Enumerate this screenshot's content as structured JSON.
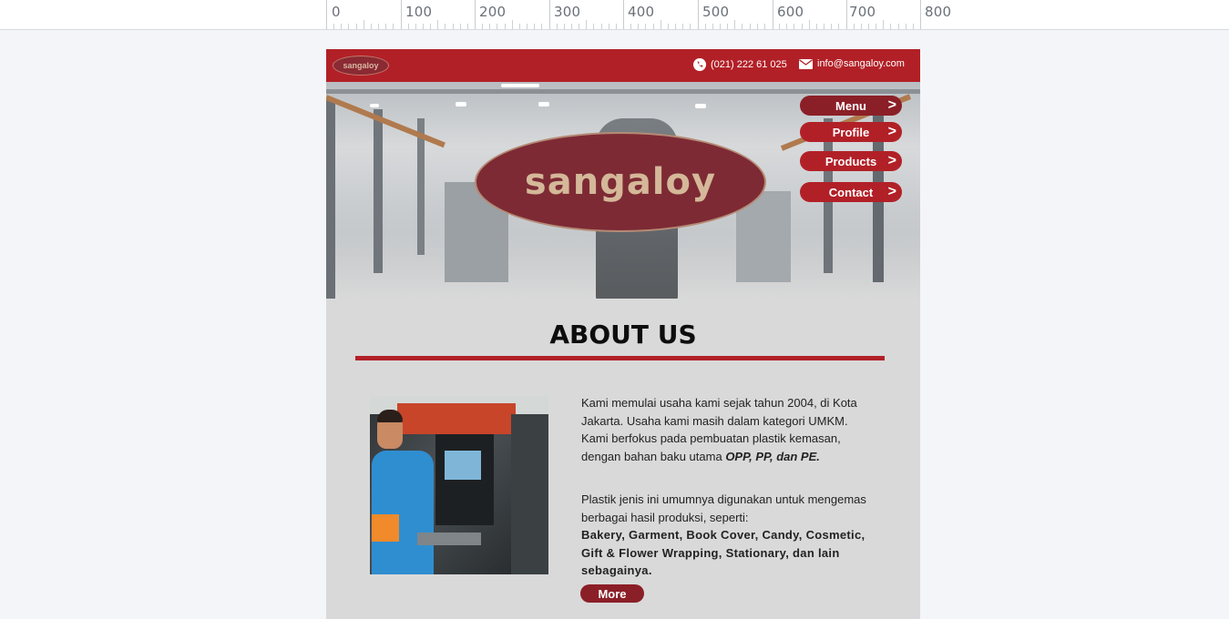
{
  "ruler": {
    "labels": [
      "0",
      "100",
      "200",
      "300",
      "400",
      "500",
      "600",
      "700",
      "800"
    ]
  },
  "topbar": {
    "logo_text": "sangaloy",
    "phone": "(021) 222 61 025",
    "email": "info@sangaloy.com",
    "phone_icon": "phone-icon",
    "email_icon": "mail-icon"
  },
  "hero": {
    "logo_text": "sangaloy"
  },
  "nav": [
    {
      "label": "Menu"
    },
    {
      "label": "Profile"
    },
    {
      "label": "Products"
    },
    {
      "label": "Contact"
    }
  ],
  "about": {
    "title": "ABOUT US",
    "p1_plain": "Kami memulai usaha kami sejak tahun 2004, di Kota Jakarta. Usaha kami masih dalam kategori UMKM. Kami berfokus pada pembuatan plastik kemasan, dengan bahan baku utama ",
    "p1_emph": "OPP, PP, dan PE.",
    "p2_plain": "Plastik jenis ini umumnya digunakan untuk mengemas berbagai hasil produksi, seperti:",
    "p2_bold": "Bakery, Garment, Book Cover, Candy, Cosmetic, Gift & Flower Wrapping, Stationary, dan lain sebagainya.",
    "more_label": "More"
  },
  "colors": {
    "brand_red": "#b22027",
    "dark_red": "#8b1f27",
    "page_bg": "#d9d9d9"
  }
}
